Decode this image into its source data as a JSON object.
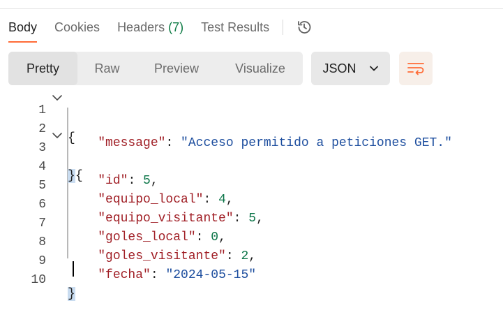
{
  "response_tabs": {
    "body": "Body",
    "cookies": "Cookies",
    "headers_label": "Headers",
    "headers_count": "(7)",
    "test_results": "Test Results",
    "history_icon": "history-icon"
  },
  "view_modes": {
    "pretty": "Pretty",
    "raw": "Raw",
    "preview": "Preview",
    "visualize": "Visualize",
    "selected": "Pretty"
  },
  "format": {
    "selected": "JSON",
    "icon": "chevron-down-icon"
  },
  "wrap_icon": "wrap-lines-icon",
  "colors": {
    "accent": "#ff6c37",
    "key": "#a01e25",
    "string": "#1c4d9e",
    "number": "#0b7548",
    "count": "#0c7a43"
  },
  "code": {
    "line_numbers": [
      "1",
      "2",
      "3",
      "4",
      "5",
      "6",
      "7",
      "8",
      "9",
      "10"
    ],
    "l1_open": "{",
    "l2_key": "\"message\"",
    "l2_sep": ": ",
    "l2_val": "\"Acceso permitido a peticiones GET.\"",
    "l3_close": "}",
    "l3_open": "{",
    "l4_key": "\"id\"",
    "l4_sep": ": ",
    "l4_val": "5",
    "l4_comma": ",",
    "l5_key": "\"equipo_local\"",
    "l5_sep": ": ",
    "l5_val": "4",
    "l5_comma": ",",
    "l6_key": "\"equipo_visitante\"",
    "l6_sep": ": ",
    "l6_val": "5",
    "l6_comma": ",",
    "l7_key": "\"goles_local\"",
    "l7_sep": ": ",
    "l7_val": "0",
    "l7_comma": ",",
    "l8_key": "\"goles_visitante\"",
    "l8_sep": ": ",
    "l8_val": "2",
    "l8_comma": ",",
    "l9_key": "\"fecha\"",
    "l9_sep": ": ",
    "l9_val": "\"2024-05-15\"",
    "l10_close": "}"
  }
}
